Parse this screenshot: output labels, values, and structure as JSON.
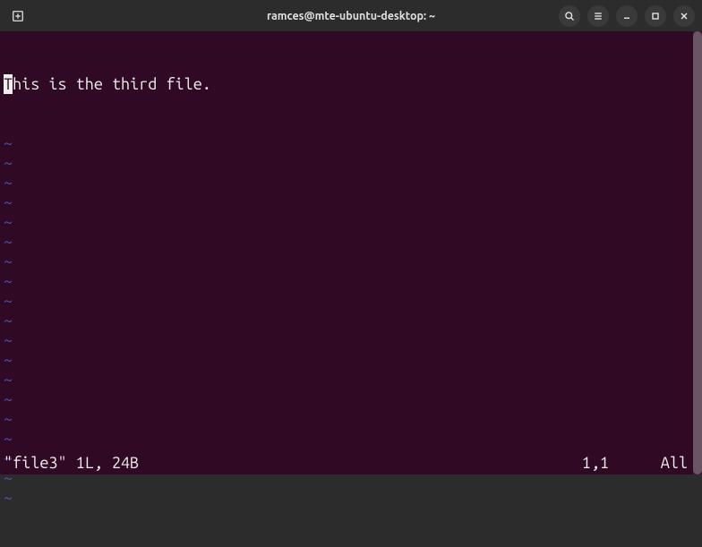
{
  "titlebar": {
    "title": "ramces@mte-ubuntu-desktop: ~"
  },
  "editor": {
    "cursor_char": "T",
    "rest_of_line": "his is the third file.",
    "tilde": "~",
    "tilde_count": 19
  },
  "status": {
    "filename": "\"file3\"",
    "file_info": " 1L, 24B",
    "position": "1,1",
    "scroll": "All"
  }
}
